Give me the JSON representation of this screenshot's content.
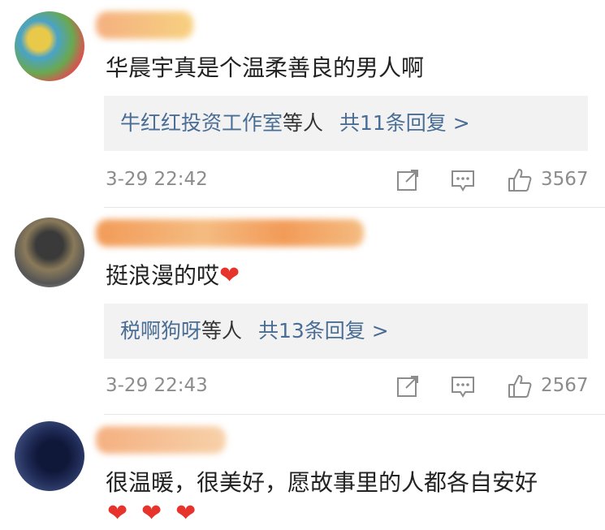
{
  "comments": [
    {
      "text": "华晨宇真是个温柔善良的男人啊",
      "reply_names": "牛红红投资工作室",
      "reply_suffix": "等人",
      "reply_count": "共11条回复 >",
      "timestamp": "3-29 22:42",
      "likes": "3567",
      "avatar_colors": [
        "#4aa3c8",
        "#e8c94a",
        "#6aa84f",
        "#d9534f"
      ],
      "name_colors": [
        "#f3a36b",
        "#f6c96b"
      ]
    },
    {
      "text": "挺浪漫的哎",
      "heart": "❤",
      "reply_names": "税啊狗呀",
      "reply_suffix": "等人",
      "reply_count": "共13条回复 >",
      "timestamp": "3-29 22:43",
      "likes": "2567",
      "avatar_colors": [
        "#555555",
        "#8a7a5a",
        "#3a3a3a"
      ],
      "name_colors": [
        "#f08a3c",
        "#f3b06b"
      ]
    },
    {
      "text": "很温暖，很美好，愿故事里的人都各自安好",
      "hearts": [
        "❤",
        "❤",
        "❤"
      ],
      "avatar_colors": [
        "#1f2a55",
        "#3a4a7a",
        "#10183a"
      ],
      "name_colors": [
        "#f3a36b",
        "#f6c99b"
      ]
    }
  ],
  "icons": {
    "share": "share-icon",
    "comment": "comment-icon",
    "like": "thumbs-up-icon"
  },
  "colors": {
    "link_blue": "#4a6d95",
    "meta_gray": "#8c8c8c",
    "reply_bg": "#f2f2f2",
    "heart_red": "#e8332c"
  }
}
